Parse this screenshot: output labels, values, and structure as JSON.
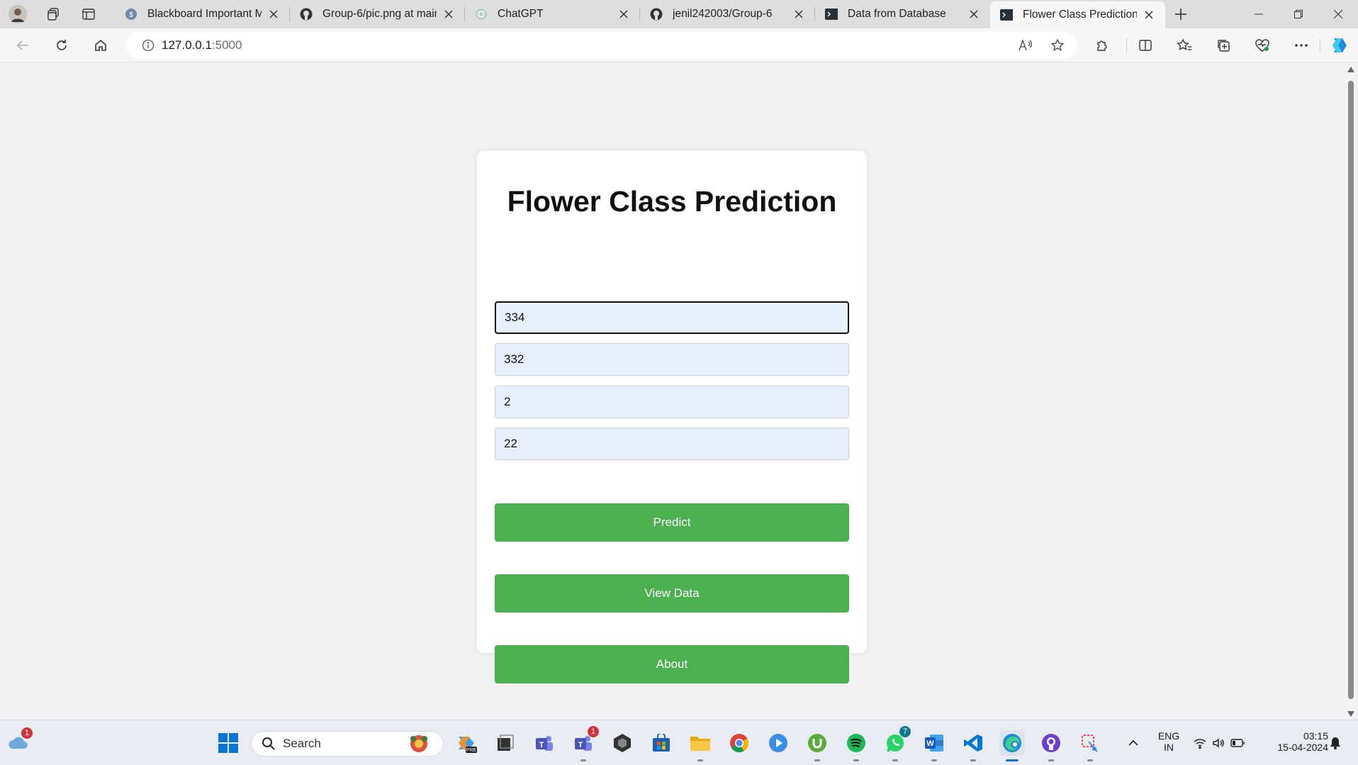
{
  "browser": {
    "tabs": [
      {
        "title": "Blackboard Important Me",
        "icon": "blackboard-icon",
        "active": false
      },
      {
        "title": "Group-6/pic.png at main",
        "icon": "github-icon",
        "active": false
      },
      {
        "title": "ChatGPT",
        "icon": "chatgpt-icon",
        "active": false
      },
      {
        "title": "jenil242003/Group-6",
        "icon": "github-icon",
        "active": false
      },
      {
        "title": "Data from Database",
        "icon": "terminal-icon",
        "active": false
      },
      {
        "title": "Flower Class Prediction",
        "icon": "terminal-icon",
        "active": true
      }
    ],
    "address": {
      "host": "127.0.0.1",
      "port": ":5000"
    }
  },
  "page": {
    "title": "Flower Class Prediction",
    "fields": [
      "334",
      "332",
      "2",
      "22"
    ],
    "buttons": {
      "predict": "Predict",
      "view_data": "View Data",
      "about": "About"
    },
    "accent": "#4caf50"
  },
  "taskbar": {
    "search_placeholder": "Search",
    "weather_badge": "1",
    "teams_badge": "1",
    "whatsapp_badge": "7",
    "lang_top": "ENG",
    "lang_bottom": "IN",
    "time": "03:15",
    "date": "15-04-2024"
  }
}
